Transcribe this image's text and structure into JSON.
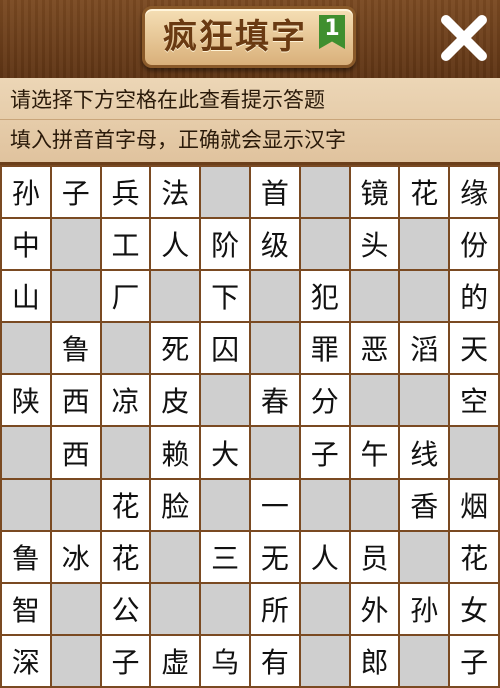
{
  "header": {
    "title": "疯狂填字",
    "level": "1",
    "close_icon": "close-icon"
  },
  "hints": {
    "line1": "请选择下方空格在此查看提示答题",
    "line2": "填入拼音首字母，正确就会显示汉字"
  },
  "colors": {
    "board_wood": "#7a4a22",
    "blank_cell": "#cfcfcf",
    "letter_cell": "#ffffff"
  },
  "grid": [
    [
      "孙",
      "子",
      "兵",
      "法",
      "",
      "首",
      "",
      "镜",
      "花",
      "缘"
    ],
    [
      "中",
      "",
      "工",
      "人",
      "阶",
      "级",
      "",
      "头",
      "",
      "份"
    ],
    [
      "山",
      "",
      "厂",
      "",
      "下",
      "",
      "犯",
      "",
      "",
      "的"
    ],
    [
      "",
      "鲁",
      "",
      "死",
      "囚",
      "",
      "罪",
      "恶",
      "滔",
      "天"
    ],
    [
      "陕",
      "西",
      "凉",
      "皮",
      "",
      "春",
      "分",
      "",
      "",
      "空"
    ],
    [
      "",
      "西",
      "",
      "赖",
      "大",
      "",
      "子",
      "午",
      "线",
      ""
    ],
    [
      "",
      "",
      "花",
      "脸",
      "",
      "一",
      "",
      "",
      "香",
      "烟"
    ],
    [
      "鲁",
      "冰",
      "花",
      "",
      "三",
      "无",
      "人",
      "员",
      "",
      "花"
    ],
    [
      "智",
      "",
      "公",
      "",
      "",
      "所",
      "",
      "外",
      "孙",
      "女"
    ],
    [
      "深",
      "",
      "子",
      "虚",
      "乌",
      "有",
      "",
      "郎",
      "",
      "子"
    ]
  ]
}
